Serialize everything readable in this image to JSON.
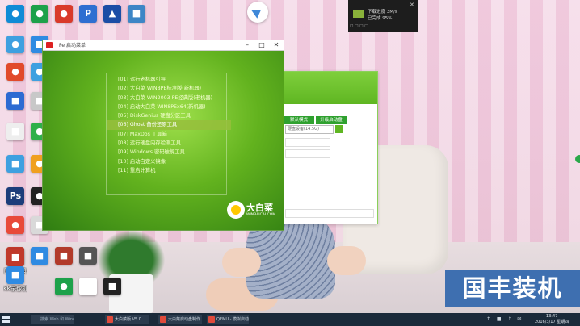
{
  "desktop_icons": [
    {
      "label": "",
      "glyph": "●",
      "color": "#0f8bd6"
    },
    {
      "label": "",
      "glyph": "●",
      "color": "#1da14a"
    },
    {
      "label": "",
      "glyph": "●",
      "color": "#d93a2a"
    },
    {
      "label": "",
      "glyph": "P",
      "color": "#2e6fd1"
    },
    {
      "label": "",
      "glyph": "▲",
      "color": "#1b4ea6"
    },
    {
      "label": "",
      "glyph": "■",
      "color": "#3d86c6"
    },
    {
      "label": "",
      "glyph": "●",
      "color": "#3ea0e0"
    },
    {
      "label": "",
      "glyph": "■",
      "color": "#2f8be2"
    },
    {
      "label": "",
      "glyph": "●",
      "color": "#e14a2a"
    },
    {
      "label": "",
      "glyph": "●",
      "color": "#3ea0e0"
    },
    {
      "label": "",
      "glyph": "■",
      "color": "#2d6bd2"
    },
    {
      "label": "",
      "glyph": "■",
      "color": "#c8c8c8"
    },
    {
      "label": "",
      "glyph": "■",
      "color": "#eeeeee"
    },
    {
      "label": "",
      "glyph": "●",
      "color": "#2fb04a"
    },
    {
      "label": "",
      "glyph": "■",
      "color": "#3ea0e0"
    },
    {
      "label": "",
      "glyph": "●",
      "color": "#f0a020"
    },
    {
      "label": "",
      "glyph": "Ps",
      "color": "#1c3d7a"
    },
    {
      "label": "",
      "glyph": "●",
      "color": "#222222"
    },
    {
      "label": "",
      "glyph": "●",
      "color": "#e84a3a"
    },
    {
      "label": "",
      "glyph": "■",
      "color": "#d9d9d9"
    },
    {
      "label": "",
      "glyph": "■",
      "color": "#c0392b"
    },
    {
      "label": "",
      "glyph": "■",
      "color": "#2f8be2"
    },
    {
      "label": "",
      "glyph": "■",
      "color": "#b23a2a"
    },
    {
      "label": "",
      "glyph": "■",
      "color": "#555555"
    },
    {
      "label": "国丰工具",
      "glyph": "■",
      "color": "#c0392b"
    },
    {
      "label": "KK录像机",
      "glyph": "■",
      "color": "#2f8be2"
    },
    {
      "label": "",
      "glyph": "●",
      "color": "#1da14a"
    },
    {
      "label": "",
      "glyph": "■",
      "color": "#ffffff"
    },
    {
      "label": "",
      "glyph": "■",
      "color": "#222222"
    }
  ],
  "green_window": {
    "title": "Pe 启动菜单",
    "menu_items": [
      "[01] 运行老机器引导",
      "[02] 大白菜 WIN8PE标准版(新机器)",
      "[03] 大白菜 WIN2003 PE经典版(老机器)",
      "[04] 启动大白菜 WIN8PEx64(新机器)",
      "[05] DiskGenius 硬盘分区工具",
      "[06] Ghost 备份还原工具",
      "[07] MaxDos 工具箱",
      "[08] 运行硬盘内存检测工具",
      "[09] Windows 密码破解工具",
      "[10] 启动自定义镜像",
      "[11] 重启计算机"
    ],
    "selected_index": 5,
    "brand_name": "大白菜",
    "brand_url": "WINBAICAI.COM"
  },
  "tool_window": {
    "tab_labels": [
      "默认模式",
      "升级启动盘"
    ],
    "field_value": "硬盘设备(14.5G)",
    "option_labels": [
      "",
      "",
      ""
    ]
  },
  "notification": {
    "line1": "下载进度 3M/s",
    "line2": "已完成 95%",
    "actions": "☐ ☐ ☐ ☐"
  },
  "watermark": "国丰装机",
  "taskbar": {
    "search_text": "搜索 Web 和 Windows",
    "items": [
      "大白菜版 V5.0",
      "大白菜启动盘制作",
      "QEMU - 模拟启动"
    ],
    "tray": "↑ ■ ♪ ✉",
    "time": "13:47",
    "date": "2016/3/17 星期四"
  }
}
